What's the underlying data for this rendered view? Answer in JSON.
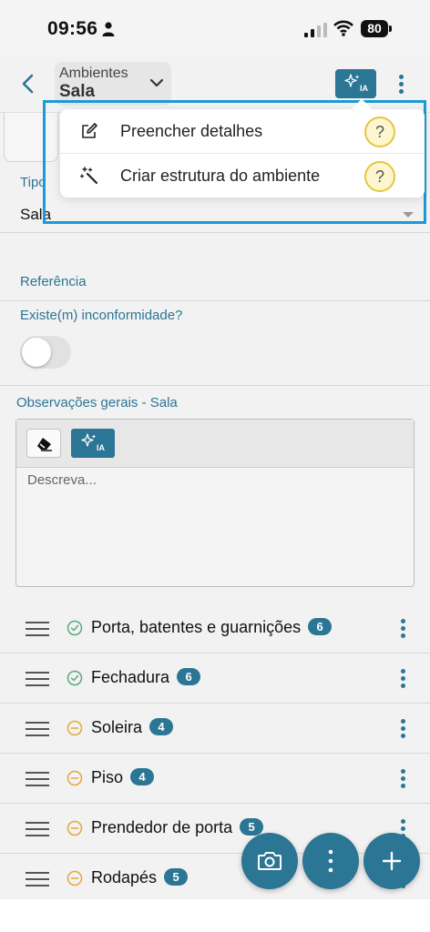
{
  "status_bar": {
    "time": "09:56",
    "battery": "80"
  },
  "header": {
    "kicker": "Ambientes",
    "title": "Sala",
    "ai_badge": "IA"
  },
  "dropdown": {
    "items": [
      {
        "label": "Preencher detalhes",
        "help": "?"
      },
      {
        "label": "Criar estrutura do ambiente",
        "help": "?"
      }
    ]
  },
  "form": {
    "tipo_label": "Tipo",
    "tipo_value": "Sala",
    "referencia_label": "Referência",
    "inconformidade_label": "Existe(m) inconformidade?",
    "inconformidade_value": false,
    "observacoes_label": "Observações gerais - Sala",
    "observacoes_placeholder": "Descreva...",
    "editor_ai_badge": "IA"
  },
  "items": [
    {
      "label": "Porta, batentes e guarnições",
      "count": "6",
      "status": "check"
    },
    {
      "label": "Fechadura",
      "count": "6",
      "status": "check"
    },
    {
      "label": "Soleira",
      "count": "4",
      "status": "pending"
    },
    {
      "label": "Piso",
      "count": "4",
      "status": "pending"
    },
    {
      "label": "Prendedor de porta",
      "count": "5",
      "status": "pending"
    },
    {
      "label": "Rodapés",
      "count": "5",
      "status": "pending"
    }
  ],
  "colors": {
    "primary": "#2b7595",
    "highlight": "#1c9ad6",
    "check": "#5aa97e",
    "pending": "#e2a93b"
  }
}
